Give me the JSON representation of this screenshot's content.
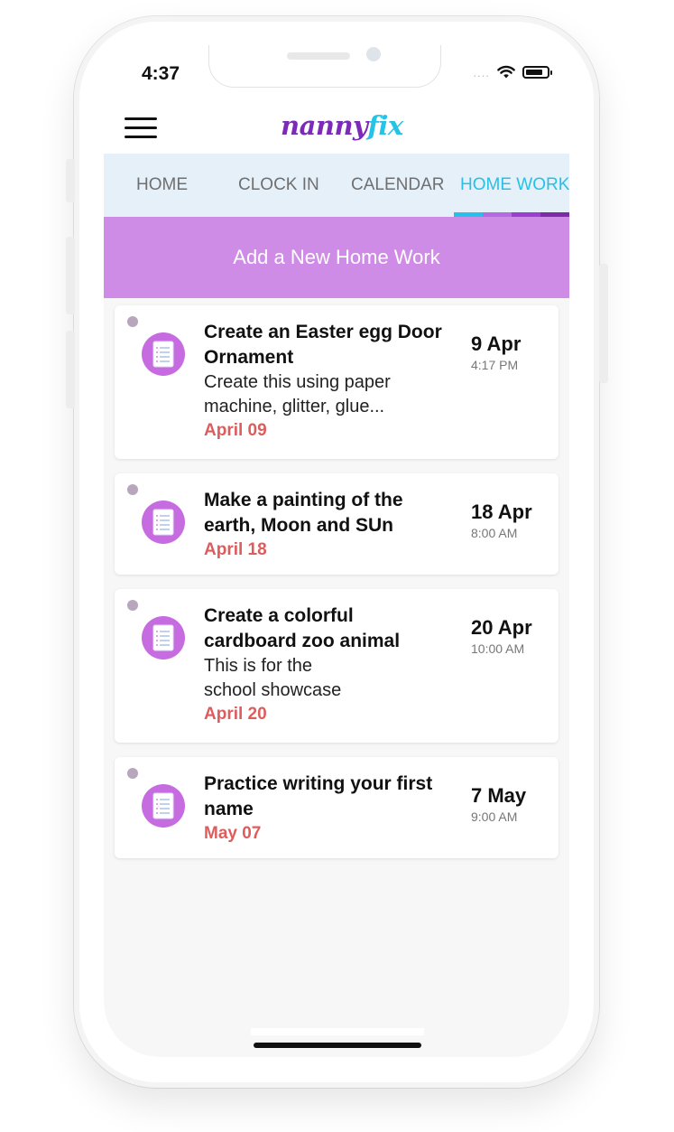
{
  "status_bar": {
    "time": "4:37",
    "signal": "....",
    "icons": [
      "wifi-icon",
      "battery-icon"
    ]
  },
  "header": {
    "logo_part1": "nanny",
    "logo_part2": "fix",
    "menu_icon": "hamburger-icon"
  },
  "tabs": [
    {
      "label": "HOME",
      "active": false
    },
    {
      "label": "CLOCK IN",
      "active": false
    },
    {
      "label": "CALENDAR",
      "active": false
    },
    {
      "label": "HOME WORK",
      "active": true
    }
  ],
  "colors": {
    "accent_cyan": "#27c0e8",
    "purple_light": "#cf8ce6",
    "purple_icon": "#c76be0",
    "due_red": "#dc5d5d",
    "tab_bg": "#e5f0f9",
    "underline": [
      "#27c0e8",
      "#b56be0",
      "#9b3fd0",
      "#7e2ba8"
    ]
  },
  "add_button": {
    "label": "Add a New Home Work"
  },
  "homework": [
    {
      "title": "Create an Easter egg Door Ornament",
      "description": "Create this using paper machine, glitter, glue...",
      "due": "April 09",
      "date": "9 Apr",
      "time": "4:17 PM",
      "icon": "homework-document-icon"
    },
    {
      "title": "Make a painting of the earth, Moon and SUn",
      "description": "",
      "due": "April 18",
      "date": "18 Apr",
      "time": "8:00 AM",
      "icon": "homework-document-icon"
    },
    {
      "title": "Create a colorful cardboard zoo animal",
      "description": "This is for the school showcase",
      "due": "April 20",
      "date": "20 Apr",
      "time": "10:00 AM",
      "icon": "homework-document-icon"
    },
    {
      "title": "Practice writing your first name",
      "description": "",
      "due": "May 07",
      "date": "7 May",
      "time": "9:00 AM",
      "icon": "homework-document-icon"
    }
  ]
}
